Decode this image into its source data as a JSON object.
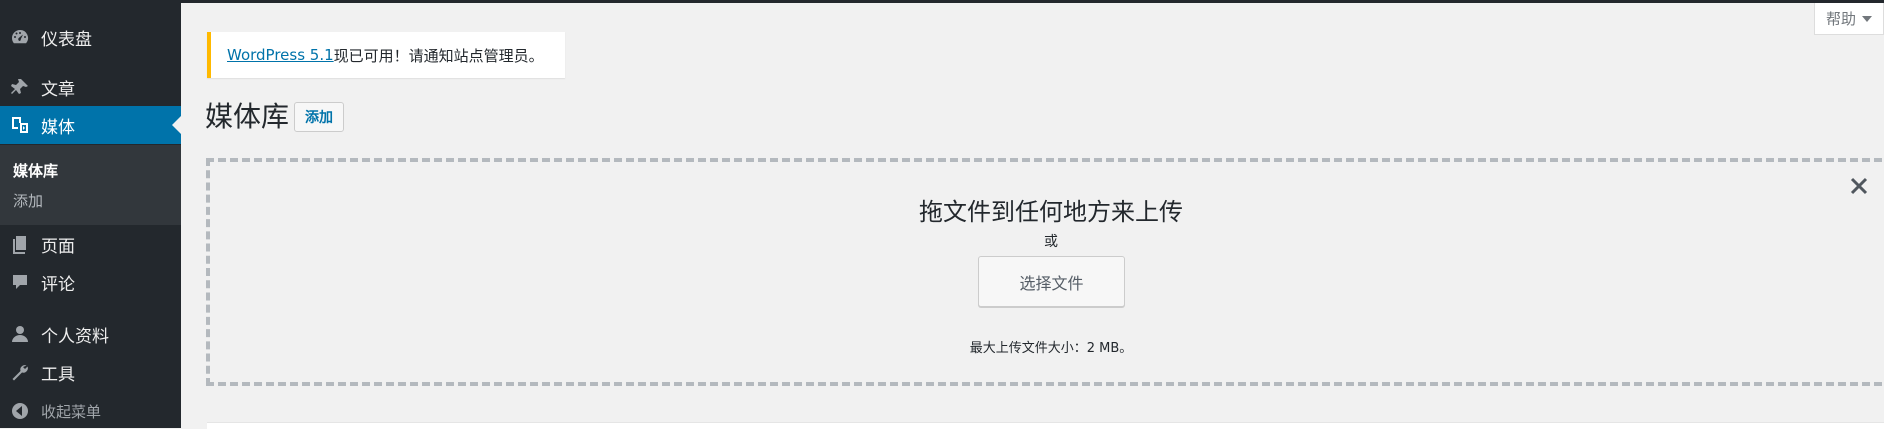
{
  "sidebar": {
    "items": [
      {
        "id": "dashboard",
        "label": "仪表盘",
        "icon": "dashboard-icon"
      },
      {
        "id": "posts",
        "label": "文章",
        "icon": "pin-icon"
      },
      {
        "id": "media",
        "label": "媒体",
        "icon": "media-icon",
        "active": true
      },
      {
        "id": "pages",
        "label": "页面",
        "icon": "pages-icon"
      },
      {
        "id": "comments",
        "label": "评论",
        "icon": "comment-icon"
      },
      {
        "id": "profile",
        "label": "个人资料",
        "icon": "user-icon"
      },
      {
        "id": "tools",
        "label": "工具",
        "icon": "wrench-icon"
      },
      {
        "id": "collapse",
        "label": "收起菜单",
        "icon": "collapse-icon"
      }
    ],
    "submenu": [
      {
        "label": "媒体库",
        "current": true
      },
      {
        "label": "添加",
        "current": false
      }
    ]
  },
  "help_tab": {
    "label": "帮助"
  },
  "notice": {
    "link_text": "WordPress 5.1",
    "text": "现已可用！请通知站点管理员。",
    "accent": "#ffb900"
  },
  "page": {
    "title": "媒体库",
    "add_button": "添加"
  },
  "upload": {
    "drop_title": "拖文件到任何地方来上传",
    "or_text": "或",
    "select_button": "选择文件",
    "max_size": "最大上传文件大小：2 MB。"
  },
  "colors": {
    "sidebar_bg": "#23282d",
    "active_bg": "#0073aa",
    "submenu_bg": "#32373c",
    "page_bg": "#f1f1f1",
    "link": "#0073aa"
  }
}
